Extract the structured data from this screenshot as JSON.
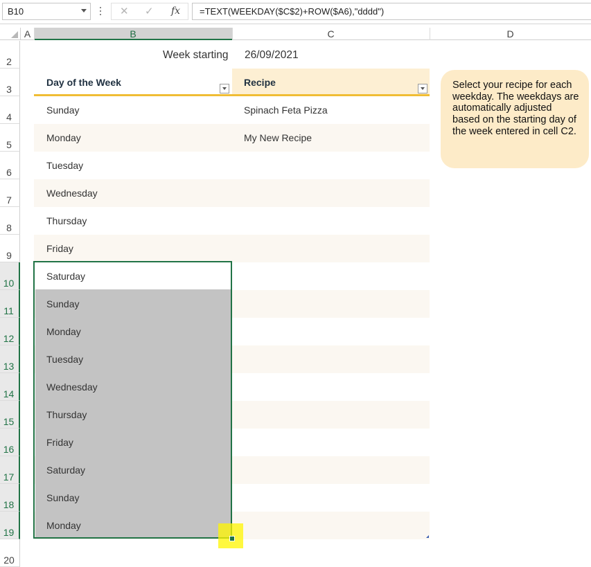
{
  "formula_bar": {
    "name_box": "B10",
    "cancel_symbol": "✕",
    "enter_symbol": "✓",
    "fx_label": "fx",
    "formula": "=TEXT(WEEKDAY($C$2)+ROW($A6),\"dddd\")"
  },
  "columns": [
    "A",
    "B",
    "C",
    "D"
  ],
  "selected_column": "B",
  "rows": [
    "2",
    "3",
    "4",
    "5",
    "6",
    "7",
    "8",
    "9",
    "10",
    "11",
    "12",
    "13",
    "14",
    "15",
    "16",
    "17",
    "18",
    "19",
    "20"
  ],
  "selected_rows": [
    "10",
    "11",
    "12",
    "13",
    "14",
    "15",
    "16",
    "17",
    "18",
    "19"
  ],
  "sheet": {
    "week_label": "Week starting",
    "week_value": "26/09/2021",
    "header_day": "Day of the Week",
    "header_recipe": "Recipe",
    "days": [
      "Sunday",
      "Monday",
      "Tuesday",
      "Wednesday",
      "Thursday",
      "Friday",
      "Saturday",
      "Sunday",
      "Monday",
      "Tuesday",
      "Wednesday",
      "Thursday",
      "Friday",
      "Saturday",
      "Sunday",
      "Monday"
    ],
    "recipes": [
      "Spinach Feta Pizza",
      "My New Recipe"
    ],
    "note": "Select your recipe for each weekday. The weekdays are automatically adjusted based on the starting day of the week entered in cell C2."
  },
  "colors": {
    "accent_underline": "#f0bd34",
    "band_fill": "#fbf7f1",
    "recipe_header_fill": "#fdefd3",
    "selection_border": "#217346",
    "note_fill": "#fdebc8",
    "highlight": "#fff500"
  },
  "icons": [
    "dropdown-arrow-icon",
    "cancel-icon",
    "enter-icon",
    "function-icon",
    "fill-handle-icon"
  ]
}
